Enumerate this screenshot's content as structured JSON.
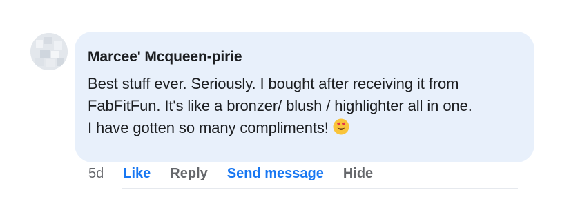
{
  "comment": {
    "author": "Marcee' Mcqueen-pirie",
    "body_lines": [
      "Best stuff ever. Seriously. I bought after receiving it from",
      "FabFitFun. It's like a bronzer/ blush / highlighter all in one.",
      "I have gotten so many compliments!"
    ],
    "emoji": "heart-eyes-emoji-icon",
    "timestamp": "5d"
  },
  "actions": {
    "like": "Like",
    "reply": "Reply",
    "send_message": "Send message",
    "hide": "Hide"
  },
  "colors": {
    "bubble": "#e8f0fb",
    "link_blue": "#1877f2",
    "muted": "#65676b",
    "text": "#1c1e21"
  }
}
